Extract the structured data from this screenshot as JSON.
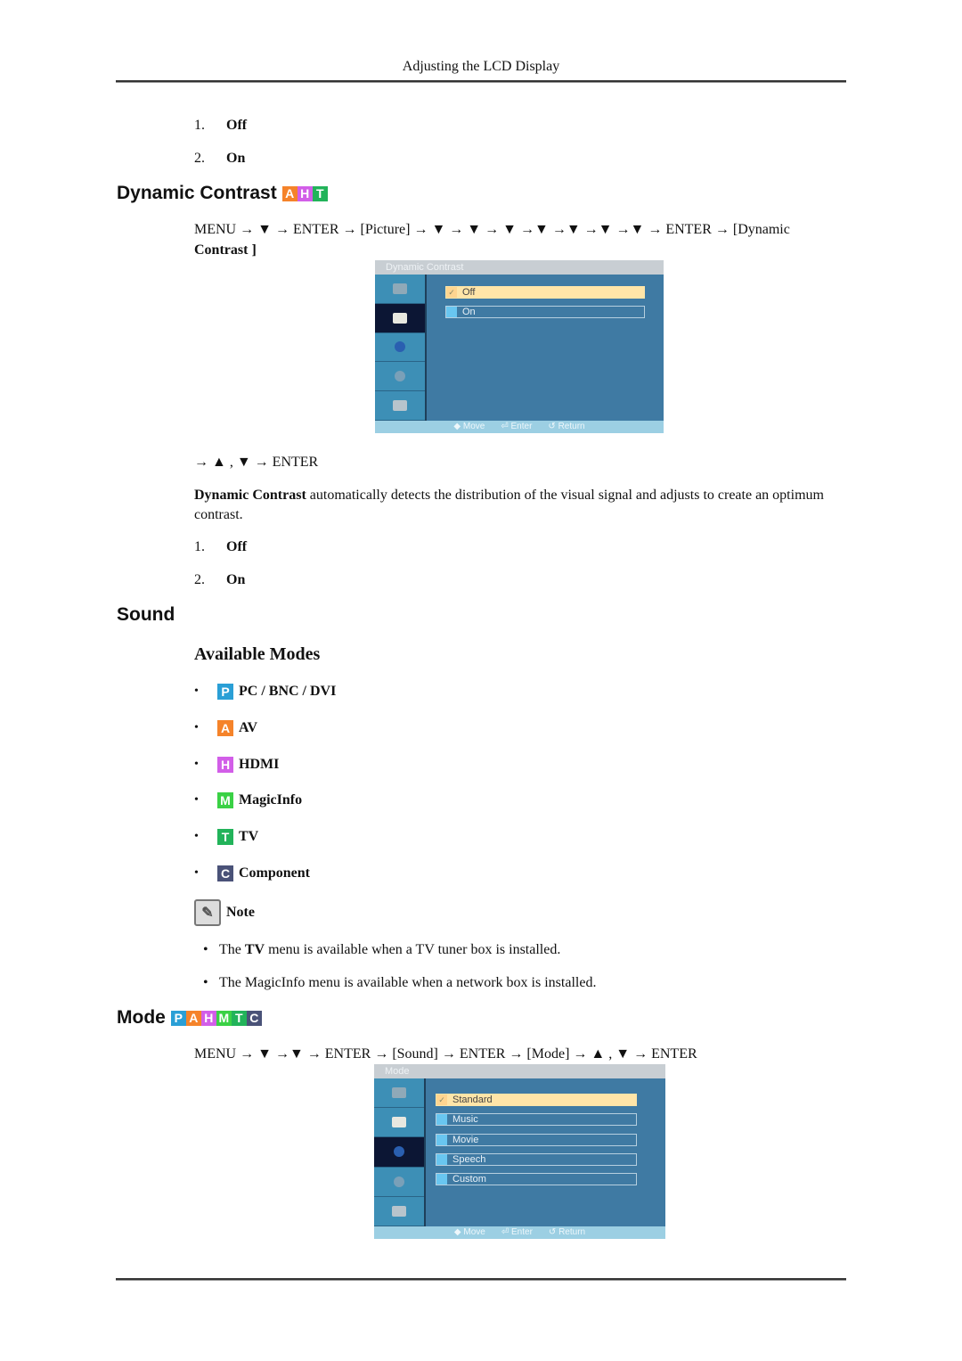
{
  "header": {
    "title": "Adjusting the LCD Display"
  },
  "top_list": [
    {
      "num": "1.",
      "label": "Off"
    },
    {
      "num": "2.",
      "label": "On"
    }
  ],
  "dynamic_contrast": {
    "heading": "Dynamic Contrast",
    "badges": [
      {
        "letter": "A",
        "color": "#f5832a"
      },
      {
        "letter": "H",
        "color": "#d25ee8"
      },
      {
        "letter": "T",
        "color": "#22b35a"
      }
    ],
    "nav_line1": "MENU → ▼ → ENTER → [Picture] → ▼ → ▼ → ▼ →▼ →▼ →▼ →▼ → ENTER → [Dynamic",
    "nav_line2": "Contrast ]",
    "osd": {
      "title": "Dynamic Contrast",
      "options": [
        {
          "label": "Off",
          "selected": true
        },
        {
          "label": "On",
          "selected": false
        }
      ],
      "active_sidebar_index": 1,
      "footer": {
        "move": "Move",
        "enter": "Enter",
        "return": "Return"
      }
    },
    "select_line": "→ ▲ , ▼ → ENTER",
    "desc_bold": "Dynamic Contrast",
    "desc_rest": " automatically detects the distribution of the visual signal and adjusts to create an optimum contrast.",
    "list": [
      {
        "num": "1.",
        "label": "Off"
      },
      {
        "num": "2.",
        "label": "On"
      }
    ]
  },
  "sound": {
    "heading": "Sound",
    "subheading": "Available Modes",
    "modes": [
      {
        "letter": "P",
        "color": "#2a9fd6",
        "label": "PC / BNC / DVI"
      },
      {
        "letter": "A",
        "color": "#f5832a",
        "label": "AV"
      },
      {
        "letter": "H",
        "color": "#d25ee8",
        "label": "HDMI"
      },
      {
        "letter": "M",
        "color": "#3ad145",
        "label": "MagicInfo"
      },
      {
        "letter": "T",
        "color": "#22b35a",
        "label": "TV"
      },
      {
        "letter": "C",
        "color": "#4a5278",
        "label": "Component"
      }
    ],
    "note_label": "Note",
    "notes": [
      {
        "pre": "The ",
        "bold": "TV",
        "post": " menu is available when a TV tuner box is installed."
      },
      {
        "pre": "The MagicInfo menu is available when a network box is installed.",
        "bold": "",
        "post": ""
      }
    ]
  },
  "mode": {
    "heading": "Mode",
    "badges": [
      {
        "letter": "P",
        "color": "#2a9fd6"
      },
      {
        "letter": "A",
        "color": "#f5832a"
      },
      {
        "letter": "H",
        "color": "#d25ee8"
      },
      {
        "letter": "M",
        "color": "#3ad145"
      },
      {
        "letter": "T",
        "color": "#22b35a"
      },
      {
        "letter": "C",
        "color": "#4a5278"
      }
    ],
    "nav_line": "MENU → ▼ →▼ → ENTER → [Sound] → ENTER → [Mode] → ▲ , ▼ → ENTER",
    "osd": {
      "title": "Mode",
      "options": [
        {
          "label": "Standard",
          "selected": true
        },
        {
          "label": "Music",
          "selected": false
        },
        {
          "label": "Movie",
          "selected": false
        },
        {
          "label": "Speech",
          "selected": false
        },
        {
          "label": "Custom",
          "selected": false
        }
      ],
      "active_sidebar_index": 2,
      "footer": {
        "move": "Move",
        "enter": "Enter",
        "return": "Return"
      }
    }
  }
}
